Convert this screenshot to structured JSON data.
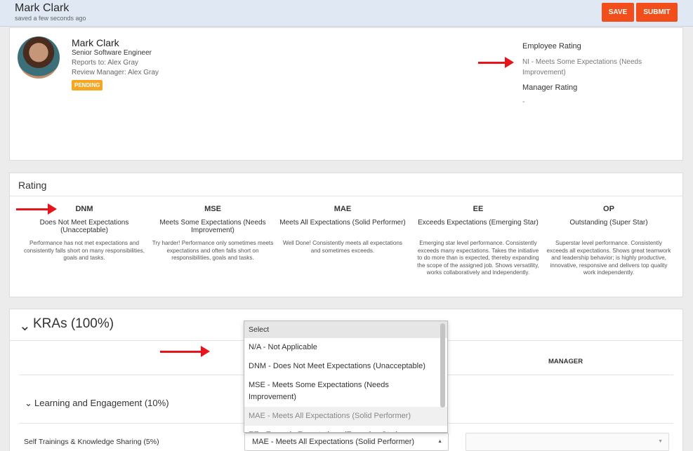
{
  "header": {
    "name": "Mark Clark",
    "saved_status": "saved a few seconds ago",
    "save_label": "SAVE",
    "submit_label": "SUBMIT",
    "accent_color": "#f14e1b"
  },
  "profile": {
    "name": "Mark Clark",
    "title": "Senior Software Engineer",
    "reports_to": "Reports to: Alex Gray",
    "review_manager": "Review Manager: Alex Gray",
    "status": "PENDING",
    "employee_rating_label": "Employee Rating",
    "employee_rating_value": "NI - Meets Some Expectations (Needs Improvement)",
    "manager_rating_label": "Manager Rating",
    "manager_rating_value": "-"
  },
  "rating": {
    "heading": "Rating",
    "levels": [
      {
        "code": "DNM",
        "title": "Does Not Meet Expectations (Unacceptable)",
        "description": "Performance has not met expectations and consistently falls short on many responsibilities, goals and tasks."
      },
      {
        "code": "MSE",
        "title": "Meets Some Expectations (Needs Improvement)",
        "description": "Try harder! Performance only sometimes meets expectations and often falls short on responsibilities, goals and tasks."
      },
      {
        "code": "MAE",
        "title": "Meets All Expectations (Solid Performer)",
        "description": "Well Done! Consistently meets all expectations and sometimes exceeds."
      },
      {
        "code": "EE",
        "title": "Exceeds Expectations (Emerging Star)",
        "description": "Emerging star level performance. Consistently exceeds many expectations. Takes the initiative to do more than is expected, thereby expanding the scope of the assigned job. Shows versatility, works collaboratively and independently."
      },
      {
        "code": "OP",
        "title": "Outstanding (Super Star)",
        "description": "Superstar level performance. Consistently exceeds all expectations. Shows great teamwork and leadership behavior; is highly productive, innovative, responsive and delivers top quality work independently."
      }
    ]
  },
  "kras": {
    "title": "KRAs (100%)",
    "manager_column": "MANAGER",
    "section_title": "Learning and Engagement (10%)",
    "row_label": "Self Trainings & Knowledge Sharing (5%)",
    "employee_selected": "MAE - Meets All Expectations (Solid Performer)",
    "manager_selected": ""
  },
  "dropdown": {
    "options": [
      "Select",
      "N/A - Not Applicable",
      "DNM - Does Not Meet Expectations (Unacceptable)",
      "MSE - Meets Some Expectations (Needs Improvement)",
      "MAE - Meets All Expectations (Solid Performer)",
      "EE - Exceeds Expectations (Emerging Star)"
    ]
  },
  "icons": {
    "collapse": "chevron-down-icon",
    "select_caret": "caret-icon",
    "annotation": "red-arrow"
  }
}
